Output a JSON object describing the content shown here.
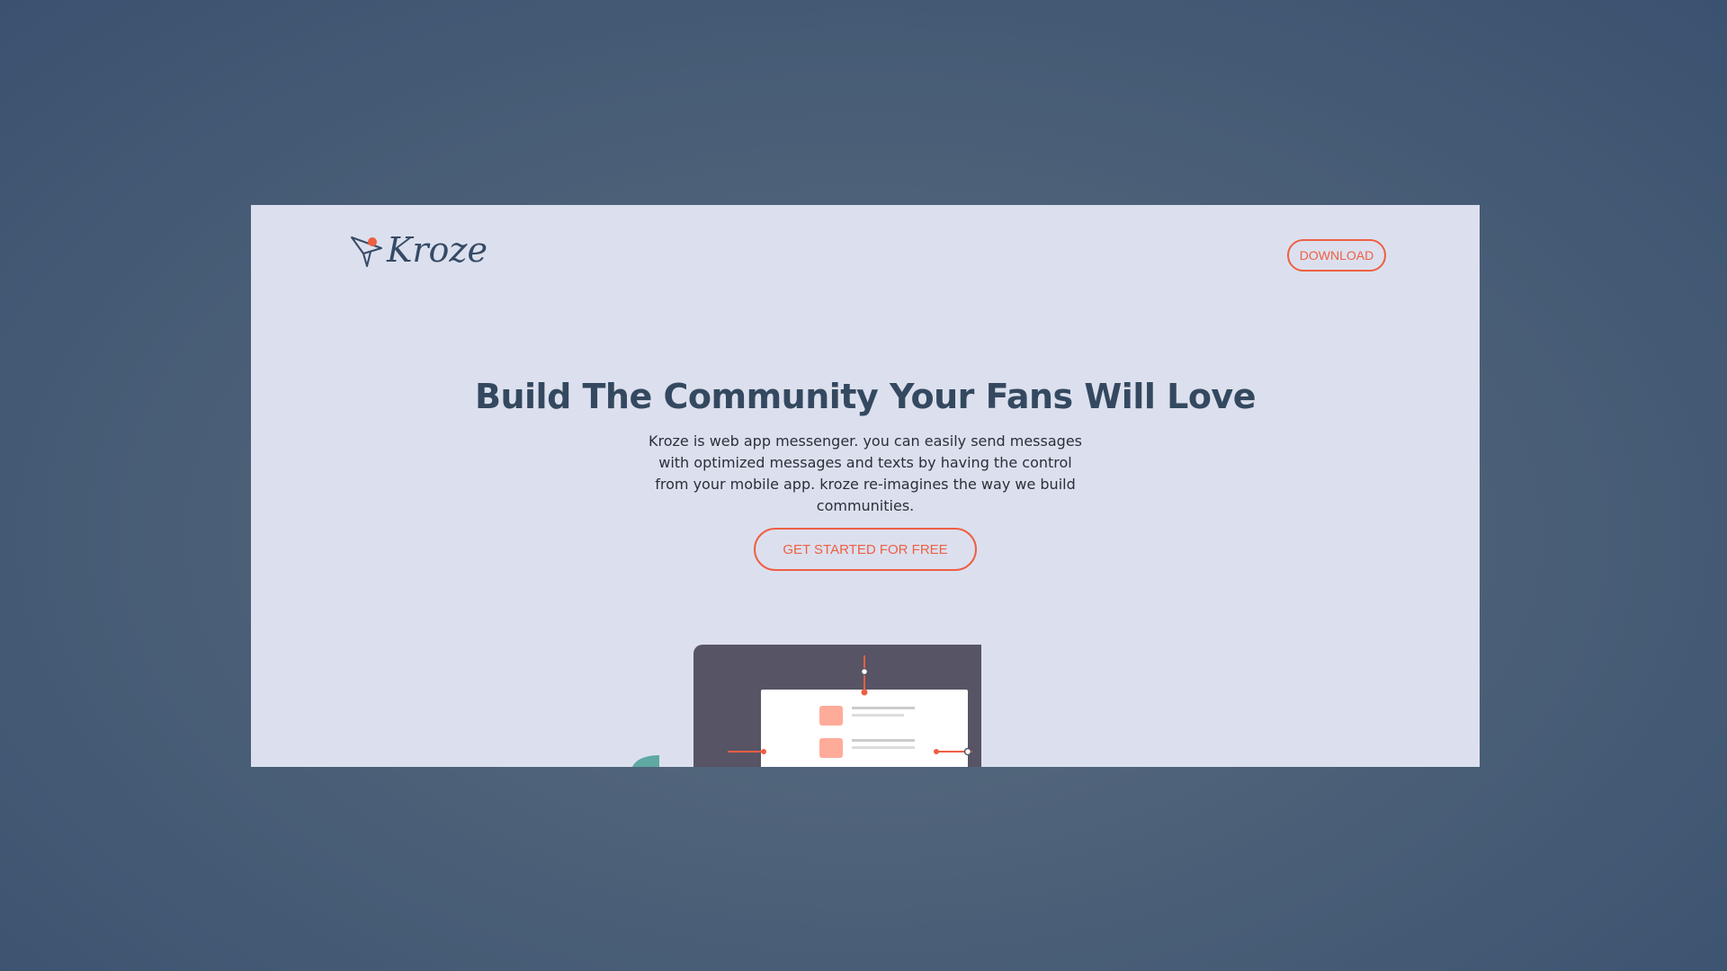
{
  "brand": {
    "name": "Kroze",
    "icon": "paper-plane-icon"
  },
  "header": {
    "download_label": "DOWNLOAD"
  },
  "hero": {
    "title": "Build The Community Your Fans Will Love",
    "description": "Kroze is web app messenger. you can easily send messages with optimized messages and texts by having the control from your mobile app. kroze re-imagines the way we build communities.",
    "cta_label": "GET STARTED FOR FREE"
  },
  "colors": {
    "accent": "#ee5f43",
    "heading": "#34495f",
    "card_background": "#dce0ee",
    "page_background": "#4d6178",
    "device_frame": "#575465",
    "chat_square": "#ffab9a",
    "teal_shape": "#5fa8a3"
  }
}
